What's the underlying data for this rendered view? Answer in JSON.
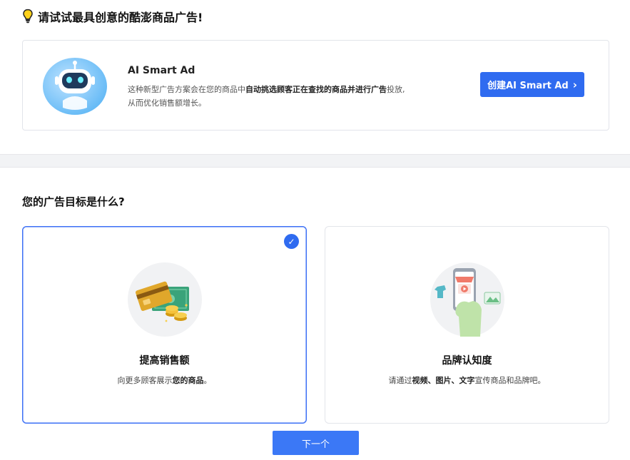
{
  "header": {
    "title": "请试试最具创意的酷澎商品广告!",
    "icon": "lightbulb-icon"
  },
  "ai_card": {
    "name": "AI Smart Ad",
    "desc_part1": "这种新型广告方案会在您的商品中",
    "desc_bold": "自动挑选顾客正在查找的商品并进行广告",
    "desc_part2": "投放,",
    "desc_line2": "从而优化销售额增长。",
    "button_label": "创建AI Smart Ad",
    "button_icon": "chevron-right-icon",
    "accent": "#2f6bf0"
  },
  "goal": {
    "title": "您的广告目标是什么?",
    "options": [
      {
        "title": "提高销售额",
        "desc_part1": "向更多顾客展示",
        "desc_bold": "您的商品",
        "desc_part2": "。",
        "icon": "credit-card-coins-icon",
        "selected": true
      },
      {
        "title": "品牌认知度",
        "desc_part1": "请通过",
        "desc_bold": "视频、图片、文字",
        "desc_part2": "宣传商品和品牌吧。",
        "icon": "phone-shop-video-icon",
        "selected": false
      }
    ]
  },
  "footer": {
    "next_label": "下一个"
  }
}
